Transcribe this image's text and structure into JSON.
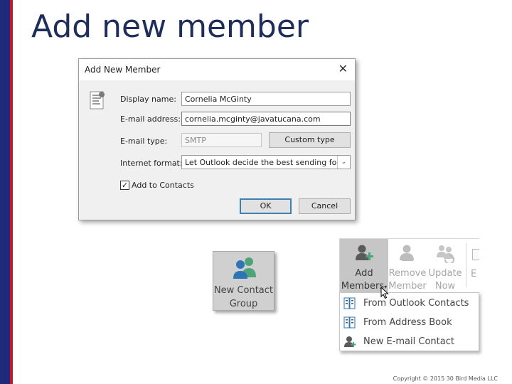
{
  "slide": {
    "title": "Add new member",
    "copyright": "Copyright © 2015 30 Bird Media LLC"
  },
  "dialog": {
    "title": "Add New Member",
    "close_label": "✕",
    "display_name_label": "Display name:",
    "display_name_value": "Cornelia McGinty",
    "email_label": "E-mail address:",
    "email_value": "cornelia.mcginty@javatucana.com",
    "email_type_label": "E-mail type:",
    "email_type_value": "SMTP",
    "custom_type_button": "Custom type",
    "internet_format_label": "Internet format:",
    "internet_format_value": "Let Outlook decide the best sending format",
    "add_to_contacts_label": "Add to Contacts",
    "add_to_contacts_checked": true,
    "ok_button": "OK",
    "cancel_button": "Cancel"
  },
  "contact_group_button": {
    "line1": "New Contact",
    "line2": "Group"
  },
  "ribbon": {
    "add_members_line1": "Add",
    "add_members_line2": "Members",
    "remove_member_line1": "Remove",
    "remove_member_line2": "Member",
    "update_now_line1": "Update",
    "update_now_line2": "Now",
    "truncated_label": "E"
  },
  "dropdown": {
    "items": [
      {
        "label": "From Outlook Contacts"
      },
      {
        "label": "From Address Book"
      },
      {
        "label": "New E-mail Contact"
      }
    ]
  },
  "colors": {
    "left_bar_blue": "#1f2a7a",
    "left_bar_red": "#c0182a",
    "title_color": "#1f2d5a",
    "ok_border": "#3c7fb1",
    "icon_blue": "#2e75b6",
    "icon_green": "#4fa37a"
  }
}
